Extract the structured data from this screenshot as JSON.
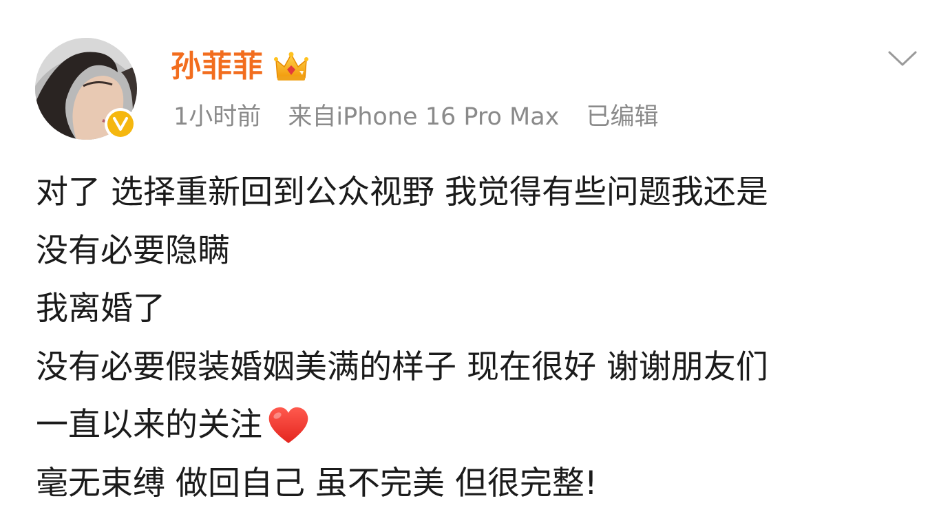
{
  "post": {
    "author": {
      "name": "孙菲菲",
      "badge_icon": "crown-icon",
      "verified_icon": "verified-v-icon",
      "verified_color": "#f5b70f",
      "name_color": "#f26d1e"
    },
    "meta": {
      "time": "1小时前",
      "source": "来自iPhone 16 Pro Max",
      "edited": "已编辑"
    },
    "menu_icon": "chevron-down-icon",
    "content_lines": [
      "对了 选择重新回到公众视野 我觉得有些问题我还是",
      "没有必要隐瞒",
      "我离婚了",
      "没有必要假装婚姻美满的样子 现在很好 谢谢朋友们",
      "一直以来的关注",
      "毫无束缚 做回自己 虽不完美 但很完整!"
    ],
    "emoji": "heart-icon"
  }
}
